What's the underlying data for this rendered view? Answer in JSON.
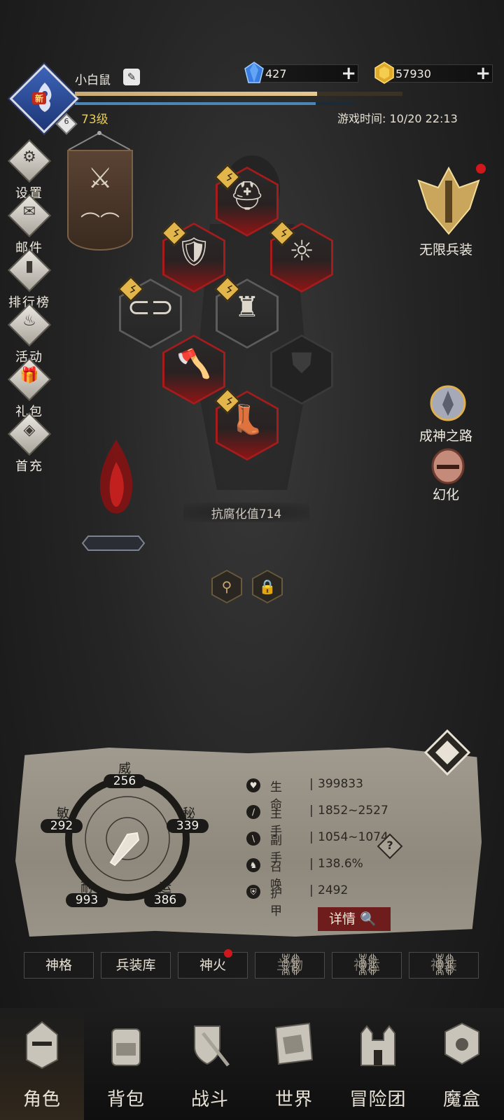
{
  "player": {
    "name": "小白鼠",
    "new_badge": "新",
    "vip_level": "6",
    "level": "73级",
    "exp_fraction": 0.74,
    "mp_fraction": 0.86,
    "game_time": "游戏时间: 10/20 22:13"
  },
  "currency": {
    "gems": "427",
    "gold": "57930"
  },
  "left_menu": [
    {
      "label": "设置",
      "icon": "gear-icon"
    },
    {
      "label": "邮件",
      "icon": "mail-icon"
    },
    {
      "label": "排行榜",
      "icon": "ranking-icon"
    },
    {
      "label": "活动",
      "icon": "event-icon"
    },
    {
      "label": "礼包",
      "icon": "gift-icon"
    },
    {
      "label": "首充",
      "icon": "first-recharge-icon"
    }
  ],
  "right_menu": {
    "infinite_equipment": "无限兵装",
    "road_to_godhood": "成神之路",
    "illusion": "幻化"
  },
  "equipment": {
    "resistance": "抗腐化值714"
  },
  "stats": {
    "radar": {
      "wei_label": "威",
      "wei_value": "256",
      "mi_label": "秘",
      "mi_value": "339",
      "yun_label": "运",
      "yun_value": "386",
      "nai_label": "耐",
      "nai_value": "993",
      "min_label": "敏",
      "min_value": "292"
    },
    "rows": [
      {
        "name": "生命",
        "value": "399833"
      },
      {
        "name": "主手",
        "value": "1852~2527"
      },
      {
        "name": "副手",
        "value": "1054~1074"
      },
      {
        "name": "召唤",
        "value": "138.6%"
      },
      {
        "name": "护甲",
        "value": "2492"
      }
    ],
    "separator": "|",
    "help": "?",
    "detail_button": "详情"
  },
  "feature_tabs": [
    {
      "label": "神格",
      "locked": false
    },
    {
      "label": "兵装库",
      "locked": false
    },
    {
      "label": "神火",
      "locked": false
    },
    {
      "label": "兰物",
      "locked": true
    },
    {
      "label": "神运",
      "locked": true
    },
    {
      "label": "神装",
      "locked": true
    }
  ],
  "bottom_nav": [
    {
      "label": "角色",
      "active": true
    },
    {
      "label": "背包",
      "active": false
    },
    {
      "label": "战斗",
      "active": false
    },
    {
      "label": "世界",
      "active": false
    },
    {
      "label": "冒险团",
      "active": false
    },
    {
      "label": "魔盒",
      "active": false
    }
  ],
  "colors": {
    "accent_red": "#a41c1c",
    "gold": "#e7cc5a",
    "exp_bar": "#d9bb80",
    "mp_bar": "#4c86b8"
  }
}
